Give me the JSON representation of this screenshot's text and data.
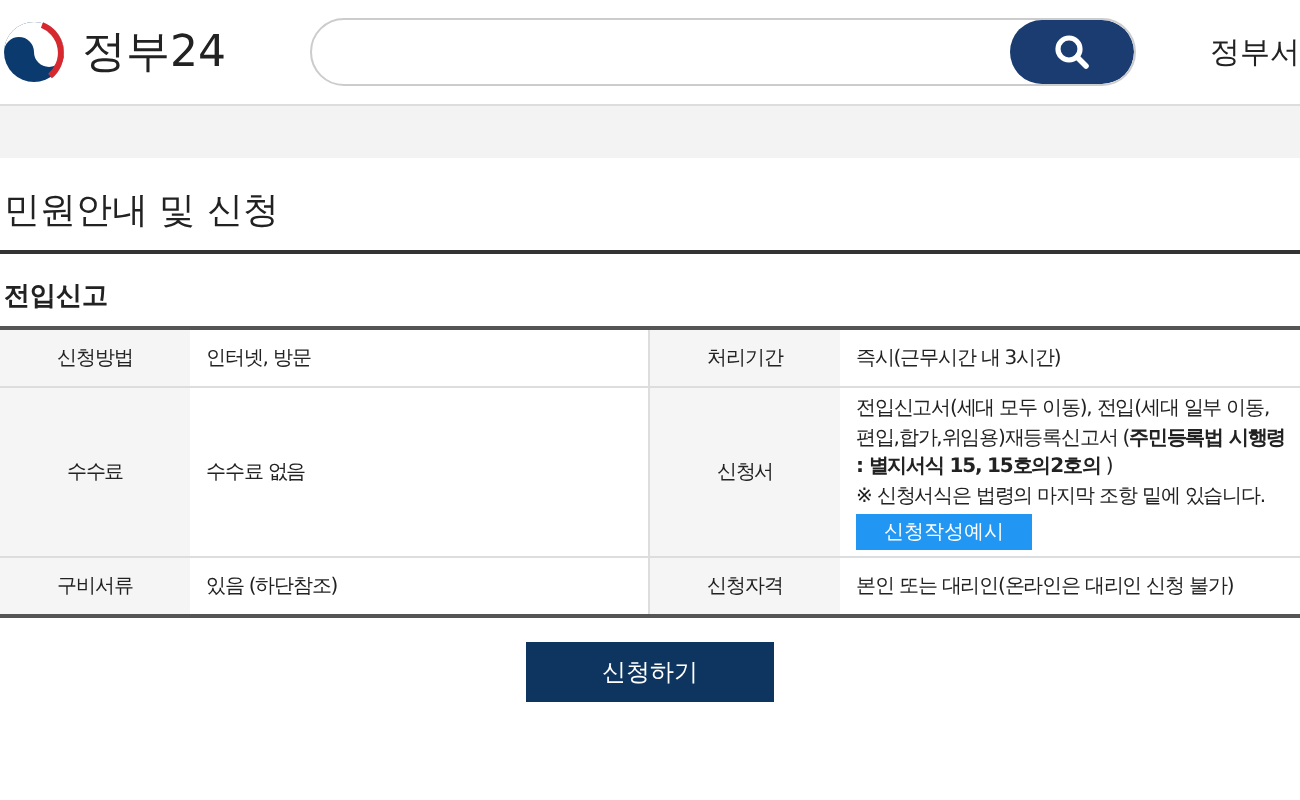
{
  "header": {
    "logo_text": "정부24",
    "nav_item": "정부서"
  },
  "page_title": "민원안내 및 신청",
  "section_title": "전입신고",
  "table": {
    "rows": [
      {
        "cells": [
          {
            "kind": "label",
            "text": "신청방법"
          },
          {
            "kind": "value",
            "text": "인터넷, 방문"
          },
          {
            "kind": "label",
            "text": "처리기간"
          },
          {
            "kind": "value",
            "text": "즉시(근무시간 내 3시간)"
          }
        ]
      },
      {
        "cells": [
          {
            "kind": "label",
            "text": "수수료"
          },
          {
            "kind": "value",
            "text": "수수료 없음"
          },
          {
            "kind": "label",
            "text": "신청서"
          },
          {
            "kind": "form",
            "text": "전입신고서(세대 모두 이동), 전입(세대 일부 이동, 편입,합가,위임용)재등록신고서 (**주민등록법 시행령 : 별지서식 15, 15호의2호의** )",
            "note": "※ 신청서식은 법령의 마지막 조항 밑에 있습니다.",
            "button": "신청작성예시"
          }
        ]
      },
      {
        "cells": [
          {
            "kind": "label",
            "text": "구비서류"
          },
          {
            "kind": "value",
            "text": "있음 (하단참조)"
          },
          {
            "kind": "label",
            "text": "신청자격"
          },
          {
            "kind": "value",
            "text": "본인 또는 대리인(온라인은 대리인 신청 불가)"
          }
        ]
      }
    ]
  },
  "apply_button": "신청하기"
}
